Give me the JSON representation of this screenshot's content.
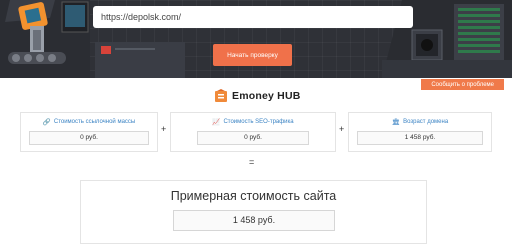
{
  "search": {
    "url_value": "https://depolsk.com/"
  },
  "actions": {
    "check_label": "Начать проверку",
    "report_label": "Сообщить о проблеме"
  },
  "brand": {
    "name": "Emoney HUB"
  },
  "cards": [
    {
      "icon": "link-icon",
      "title": "Стоимость ссылочной массы",
      "value": "0 руб."
    },
    {
      "icon": "chart-icon",
      "title": "Стоимость SEO-трафика",
      "value": "0 руб."
    },
    {
      "icon": "bank-icon",
      "title": "Возраст домена",
      "value": "1 458 руб."
    }
  ],
  "operators": {
    "plus": "+",
    "equals": "="
  },
  "result": {
    "title": "Примерная стоимость сайта",
    "value": "1 458 руб."
  },
  "colors": {
    "accent": "#f0714a",
    "link": "#3c84c4",
    "hero_bg": "#2f3137"
  }
}
